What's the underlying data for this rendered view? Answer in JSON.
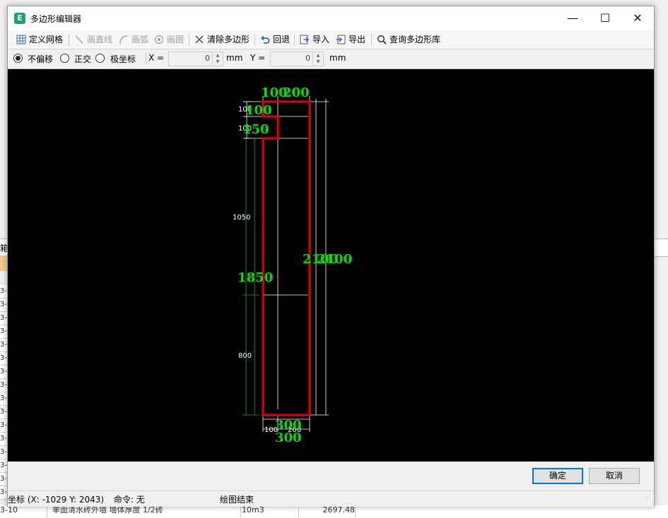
{
  "dialog": {
    "title": "多边形编辑器",
    "window_buttons": {
      "minimize": "—",
      "maximize": "☐",
      "close": "✕"
    }
  },
  "toolbar": {
    "define_grid": "定义网格",
    "draw_line": "画直线",
    "draw_arc": "画弧",
    "draw_circle": "画圆",
    "clear_polygon": "清除多边形",
    "undo": "回退",
    "import": "导入",
    "export": "导出",
    "query_library": "查询多边形库"
  },
  "options": {
    "no_offset": "不偏移",
    "orthogonal": "正交",
    "polar": "极坐标",
    "selected": "no_offset",
    "x_label": "X =",
    "x_value": "0",
    "x_unit": "mm",
    "y_label": "Y =",
    "y_value": "0",
    "y_unit": "mm"
  },
  "drawing": {
    "top_dims": [
      "100",
      "200"
    ],
    "left_small_dims": [
      "100",
      "100"
    ],
    "left_big_labels": [
      "100",
      "150"
    ],
    "left_dims": [
      "1050",
      "800"
    ],
    "height_label": "1850",
    "right_labels": [
      "2100",
      "2100"
    ],
    "bottom_dims": [
      "100",
      "200"
    ],
    "bottom_big": [
      "300",
      "300"
    ],
    "colors": {
      "outline": "#e00000",
      "dim_text": "#00e000",
      "dim_line": "#ffffff",
      "green_line": "#2ea02e"
    }
  },
  "footer": {
    "ok": "确定",
    "cancel": "取消"
  },
  "status": {
    "coords": "坐标 (X: -1029 Y: 2043)",
    "command": "命令: 无",
    "message": "绘图结束"
  },
  "background": {
    "header_glyph": "箱",
    "row_prefix": "3-",
    "bottom_row": {
      "code": "3-10",
      "desc": "单面清水砖外墙 墙体厚度 1/2砖",
      "unit": "10m3",
      "value": "2697.48"
    }
  }
}
